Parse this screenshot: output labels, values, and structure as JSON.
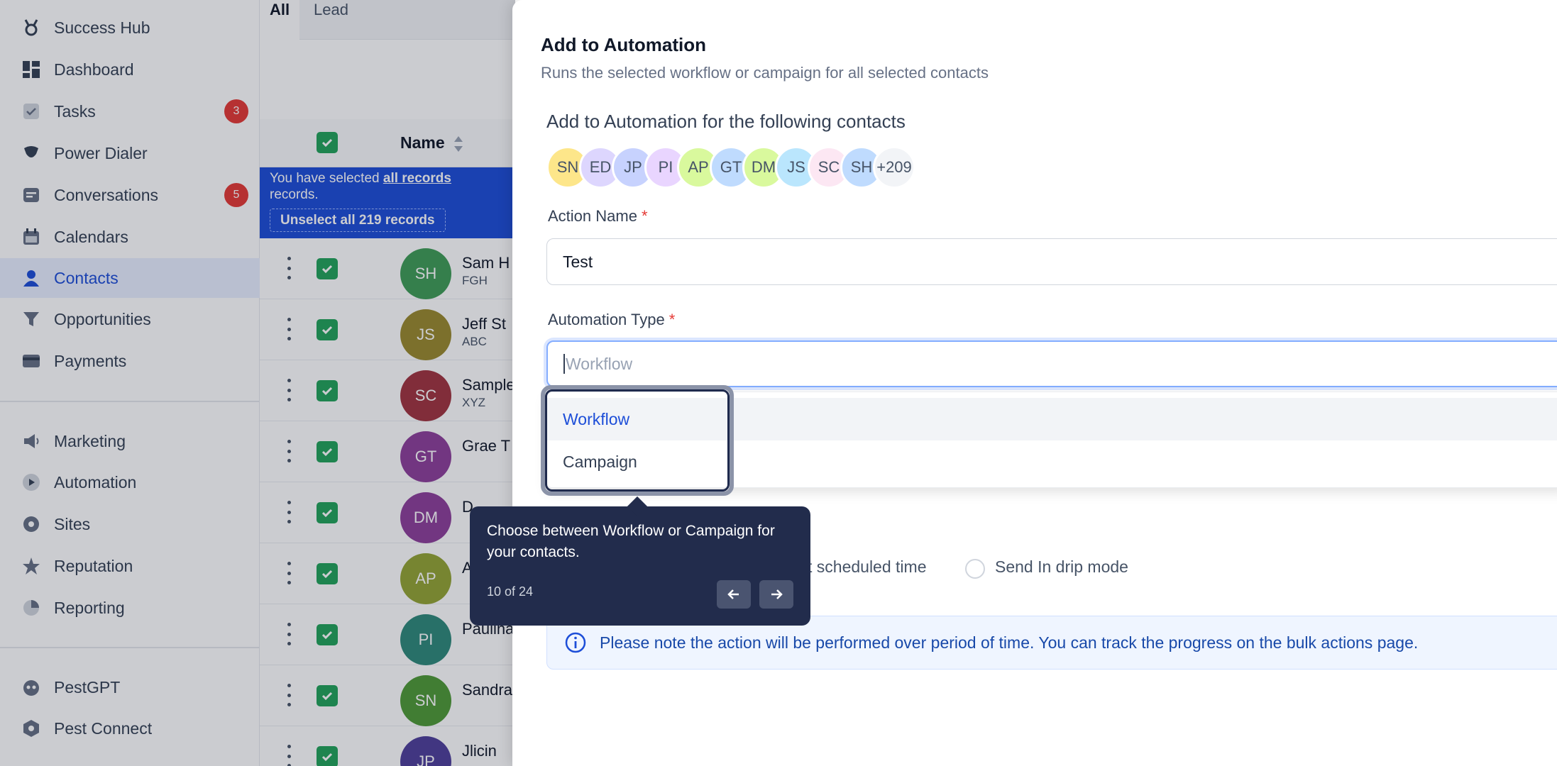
{
  "sidebar": {
    "top_items": [
      {
        "label": "Success Hub",
        "icon": "medal-icon"
      },
      {
        "label": "Dashboard",
        "icon": "dashboard-icon"
      },
      {
        "label": "Tasks",
        "icon": "checkbox-icon",
        "badge": "3"
      },
      {
        "label": "Power Dialer",
        "icon": "dialer-icon"
      },
      {
        "label": "Conversations",
        "icon": "chat-icon",
        "badge": "5"
      },
      {
        "label": "Calendars",
        "icon": "calendar-icon"
      },
      {
        "label": "Contacts",
        "icon": "person-icon",
        "active": true
      },
      {
        "label": "Opportunities",
        "icon": "funnel-icon"
      },
      {
        "label": "Payments",
        "icon": "card-icon"
      }
    ],
    "mid_items": [
      {
        "label": "Marketing",
        "icon": "megaphone-icon"
      },
      {
        "label": "Automation",
        "icon": "play-circle-icon"
      },
      {
        "label": "Sites",
        "icon": "globe-icon"
      },
      {
        "label": "Reputation",
        "icon": "star-icon"
      },
      {
        "label": "Reporting",
        "icon": "pie-chart-icon"
      }
    ],
    "bottom_items": [
      {
        "label": "PestGPT",
        "icon": "bot-icon"
      },
      {
        "label": "Pest Connect",
        "icon": "hexagon-icon"
      }
    ]
  },
  "contacts": {
    "tabs": [
      "All",
      "Lead"
    ],
    "column_name": "Name",
    "banner": {
      "prefix": "You have selected",
      "link": "all records",
      "suffix": "records.",
      "unselect_label": "Unselect all 219 records"
    },
    "rows": [
      {
        "initials": "SH",
        "name": "Sam H",
        "company": "FGH",
        "color": "#3f9d57"
      },
      {
        "initials": "JS",
        "name": "Jeff St",
        "company": "ABC",
        "color": "#9a8a2e"
      },
      {
        "initials": "SC",
        "name": "Sample",
        "company": "XYZ",
        "color": "#a0343f"
      },
      {
        "initials": "GT",
        "name": "Grae T",
        "company": "",
        "color": "#8e3f9a"
      },
      {
        "initials": "DM",
        "name": "D",
        "company": "",
        "color": "#8e3f9a"
      },
      {
        "initials": "AP",
        "name": "A",
        "company": "",
        "color": "#94a434"
      },
      {
        "initials": "PI",
        "name": "Paulina",
        "company": "",
        "color": "#2f8a7a"
      },
      {
        "initials": "SN",
        "name": "Sandra",
        "company": "",
        "color": "#4f9a36"
      },
      {
        "initials": "JP",
        "name": "Jlicin",
        "company": "",
        "color": "#4f3f9a"
      }
    ]
  },
  "modal": {
    "title": "Add to Automation",
    "subtitle": "Runs the selected workflow or campaign for all selected contacts",
    "contacts_heading": "Add to Automation for the following contacts",
    "avatars": [
      {
        "initials": "SN",
        "color": "#fde68a"
      },
      {
        "initials": "ED",
        "color": "#ddd6fe"
      },
      {
        "initials": "JP",
        "color": "#c7d2fe"
      },
      {
        "initials": "PI",
        "color": "#e9d5ff"
      },
      {
        "initials": "AP",
        "color": "#d9f99d"
      },
      {
        "initials": "GT",
        "color": "#bfdbfe"
      },
      {
        "initials": "DM",
        "color": "#d9f99d"
      },
      {
        "initials": "JS",
        "color": "#bae6fd"
      },
      {
        "initials": "SC",
        "color": "#fce7f3"
      },
      {
        "initials": "SH",
        "color": "#bfdbfe"
      },
      {
        "initials": "+209",
        "color": "#f2f4f7"
      }
    ],
    "action_name_label": "Action Name",
    "action_name_value": "Test",
    "automation_type_label": "Automation Type",
    "automation_type_placeholder": "Workflow",
    "options": [
      "Workflow",
      "Campaign"
    ],
    "radio_scheduled": "t scheduled time",
    "radio_drip": "Send In drip mode",
    "info_text": "Please note the action will be performed over period of time. You can track the progress on the bulk actions page.",
    "required_mark": "*"
  },
  "tooltip": {
    "text": "Choose between Workflow or Campaign for your contacts.",
    "step": "10 of 24"
  },
  "colors": {
    "accent": "#1d4ed8",
    "badge": "#e53935",
    "checkbox": "#22a35a",
    "tooltip_bg": "#222c4c"
  }
}
